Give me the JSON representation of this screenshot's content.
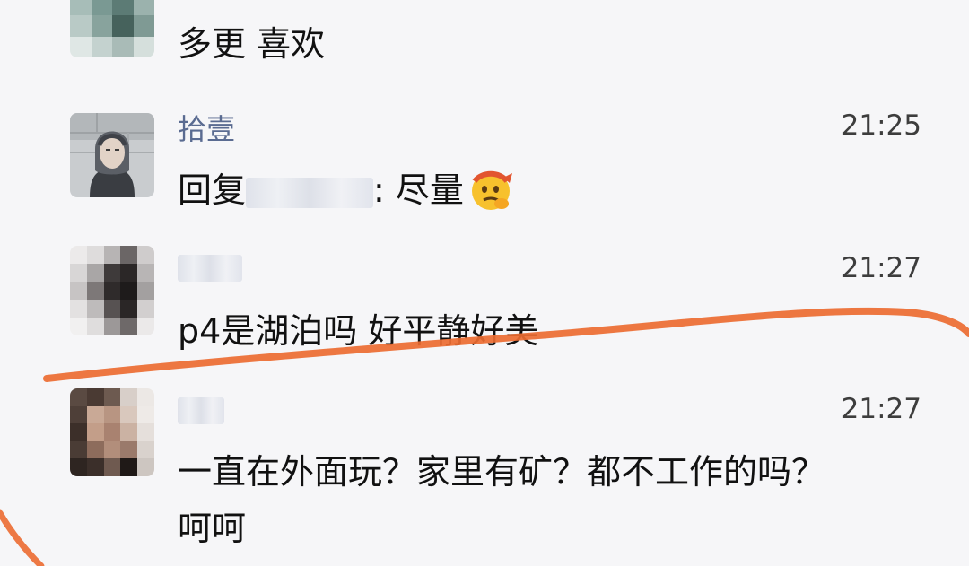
{
  "messages": [
    {
      "id": "top",
      "sender": "",
      "time": "",
      "text": "多更 喜欢"
    },
    {
      "id": "m1",
      "sender": "拾壹",
      "time": "21:25",
      "text_prefix": "回复",
      "text_suffix": ": 尽量"
    },
    {
      "id": "m2",
      "sender": "",
      "time": "21:27",
      "text": "p4是湖泊吗 好平静好美"
    },
    {
      "id": "m3",
      "sender": "",
      "time": "21:27",
      "text_line1": "一直在外面玩？家里有矿？都不工作的吗？",
      "text_line2": "呵呵"
    }
  ],
  "colors": {
    "background": "#f6f6f8",
    "sender_name": "#5a6b91",
    "annotation_stroke": "#ec6b31"
  },
  "icons": {
    "emoji": "saluting-face-emoji"
  }
}
